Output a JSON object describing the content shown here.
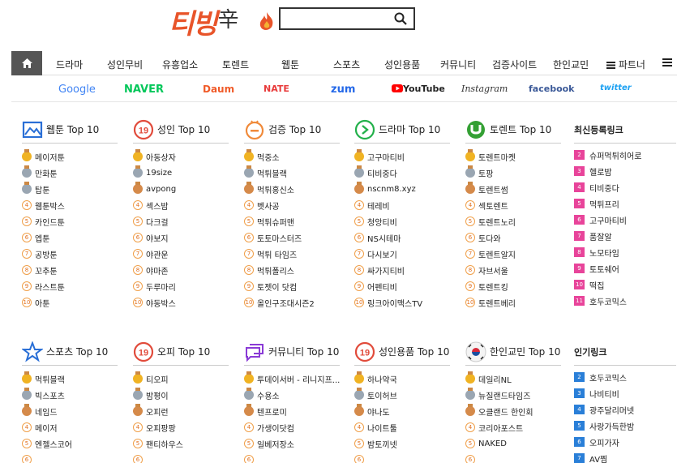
{
  "header": {
    "logo_text": "티빙",
    "logo_mark": "辛",
    "search_placeholder": ""
  },
  "nav": {
    "items": [
      "드라마",
      "성인무비",
      "유흥업소",
      "토렌트",
      "웹툰",
      "스포츠",
      "성인용품",
      "커뮤니티",
      "검증사이트",
      "한인교민",
      "파트너"
    ]
  },
  "portals": {
    "items": [
      {
        "label": "Google",
        "color": "#4285f4"
      },
      {
        "label": "NAVER",
        "color": "#03c75a"
      },
      {
        "label": "Daum",
        "color": "#f05a28"
      },
      {
        "label": "NATE",
        "color": "#e83a3a"
      },
      {
        "label": "zum",
        "color": "#2468e8"
      },
      {
        "label": "YouTube",
        "color": "#222222"
      },
      {
        "label": "Instagram",
        "color": "#333333"
      },
      {
        "label": "facebook",
        "color": "#3b5998"
      },
      {
        "label": "twitter",
        "color": "#1da1f2"
      }
    ]
  },
  "sections_row1": [
    {
      "title": "웹툰",
      "suffix": "Top 10",
      "icon": "image-chart-icon",
      "items": [
        "메이저툰",
        "만화툰",
        "탑툰",
        "웹툰박스",
        "카인드툰",
        "엡툰",
        "공방툰",
        "꼬추툰",
        "라스트툰",
        "아툰"
      ]
    },
    {
      "title": "성인",
      "suffix": "Top 10",
      "icon": "age-19-icon",
      "items": [
        "아동상자",
        "19size",
        "avpong",
        "섹스밤",
        "다크걸",
        "야보지",
        "야관운",
        "야마존",
        "두루마리",
        "야동박스"
      ]
    },
    {
      "title": "검증",
      "suffix": "Top 10",
      "icon": "verify-badge-icon",
      "items": [
        "먹중소",
        "먹튀블랙",
        "먹튀홍신소",
        "벳사공",
        "먹튀슈퍼맨",
        "토토마스터즈",
        "먹튀 타임즈",
        "먹튀폴리스",
        "토젯이 닷컴",
        "올인구조대시즌2"
      ]
    },
    {
      "title": "드라마",
      "suffix": "Top 10",
      "icon": "play-circle-icon",
      "items": [
        "고구마티비",
        "티비중다",
        "nscnm8.xyz",
        "테레비",
        "청앙티비",
        "NS시테마",
        "다시보기",
        "싸가지티비",
        "어펜티비",
        "링크아이맥스TV"
      ]
    },
    {
      "title": "토렌트",
      "suffix": "Top 10",
      "icon": "utorrent-icon",
      "items": [
        "토렌트마켓",
        "토팡",
        "토렌트썸",
        "섹토렌트",
        "토렌트노리",
        "토다와",
        "토렌트알지",
        "자브서울",
        "토렌트킹",
        "토렌트베리"
      ]
    }
  ],
  "sections_row2": [
    {
      "title": "스포츠",
      "suffix": "Top 10",
      "icon": "star-icon",
      "items": [
        "먹튀블랙",
        "빅스포츠",
        "네임드",
        "메이저",
        "엔젤스코어",
        ""
      ]
    },
    {
      "title": "오피",
      "suffix": "Top 10",
      "icon": "age-19-icon",
      "items": [
        "티오피",
        "밤평이",
        "오피런",
        "오피팡팡",
        "팬티하우스",
        ""
      ]
    },
    {
      "title": "커뮤니티",
      "suffix": "Top 10",
      "icon": "chat-bubbles-icon",
      "items": [
        "투데이서버 - 리니지프...",
        "수용소",
        "텐프로미",
        "가생이닷컴",
        "일베저장소",
        ""
      ]
    },
    {
      "title": "성인용품",
      "suffix": "Top 10",
      "icon": "age-19-icon",
      "items": [
        "하나약국",
        "토이허브",
        "야나도",
        "나이트툴",
        "밤토끼넷",
        ""
      ]
    },
    {
      "title": "한인교민",
      "suffix": "Top 10",
      "icon": "korea-flag-icon",
      "items": [
        "데일리NL",
        "뉴질랜드타임즈",
        "오클랜드 한인회",
        "코리아포스트",
        "NAKED",
        ""
      ]
    }
  ],
  "side_new": {
    "title": "최신등록링크",
    "items": [
      "슈퍼먹튀히어로",
      "헬로밤",
      "티비중다",
      "먹튀프리",
      "고구마티비",
      "품잘알",
      "노모타임",
      "토토쉐어",
      "떡집",
      "호두코믹스"
    ],
    "numbers": [
      "2",
      "3",
      "4",
      "5",
      "6",
      "7",
      "8",
      "9",
      "10",
      "11"
    ]
  },
  "side_popular": {
    "title": "인기링크",
    "items": [
      "호두코믹스",
      "나비티비",
      "광주달리머넷",
      "사랑가득한밤",
      "오피가자",
      "AV찜"
    ],
    "numbers": [
      "2",
      "3",
      "4",
      "5",
      "6",
      "7"
    ]
  },
  "colors": {
    "accent": "#e8542a",
    "nav_home_bg": "#555555",
    "new_badge": "#e8449a",
    "popular_badge": "#2a7fd8"
  }
}
